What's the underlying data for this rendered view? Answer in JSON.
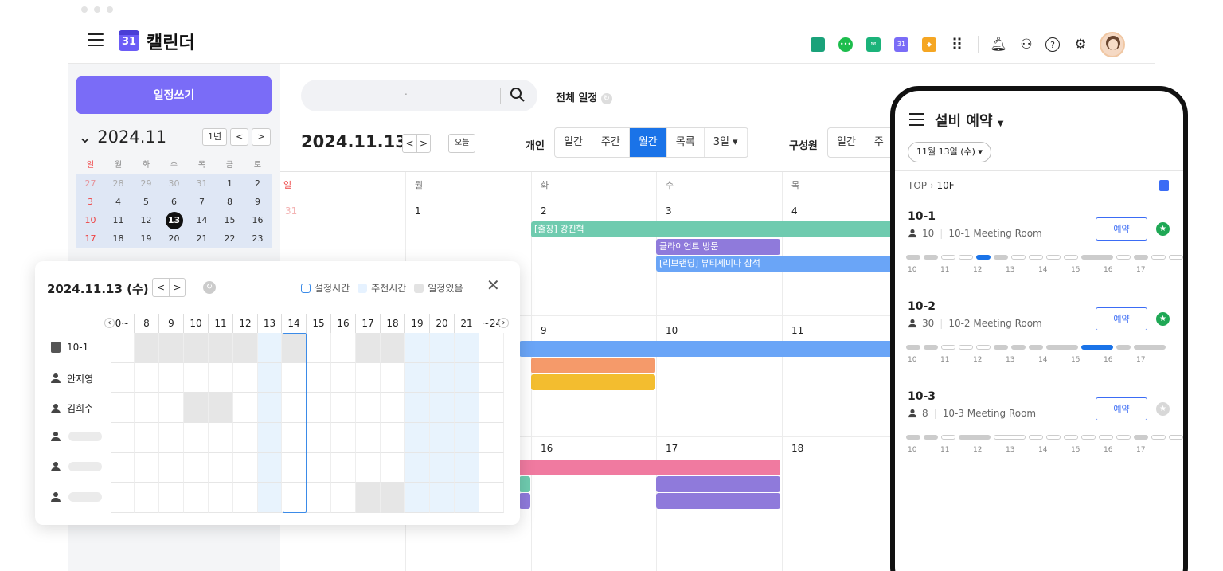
{
  "app": {
    "title": "캘린더",
    "logo_text": "31"
  },
  "toolbar": {
    "icons": [
      {
        "name": "dashboard-icon",
        "color": "#1aa27a",
        "label": ""
      },
      {
        "name": "messenger-icon",
        "color": "#1dbd4d",
        "label": "•••"
      },
      {
        "name": "mail-icon",
        "color": "#1bb37a",
        "label": "✉"
      },
      {
        "name": "calendar-app-icon",
        "color": "#7a6cf7",
        "label": "31"
      },
      {
        "name": "cube-icon",
        "color": "#f5a623",
        "label": "◆"
      },
      {
        "name": "apps-grid-icon",
        "color": "#222",
        "label": "⠿"
      }
    ],
    "utility": [
      {
        "name": "bell-icon",
        "glyph": "🔔︎"
      },
      {
        "name": "org-chart-icon",
        "glyph": "⚇"
      },
      {
        "name": "help-icon",
        "glyph": "?"
      },
      {
        "name": "settings-icon",
        "glyph": "⚙"
      }
    ]
  },
  "sidebar": {
    "write_label": "일정쓰기",
    "month": "2024.11",
    "year_btn": "1년",
    "weekdays": [
      "일",
      "월",
      "화",
      "수",
      "목",
      "금",
      "토"
    ],
    "weeks": [
      [
        "27",
        "28",
        "29",
        "30",
        "31",
        "1",
        "2"
      ],
      [
        "3",
        "4",
        "5",
        "6",
        "7",
        "8",
        "9"
      ],
      [
        "10",
        "11",
        "12",
        "13",
        "14",
        "15",
        "16"
      ],
      [
        "17",
        "18",
        "19",
        "20",
        "21",
        "22",
        "23"
      ]
    ],
    "today": "13"
  },
  "main": {
    "search_placeholder": ".",
    "all_label": "전체 일정",
    "date": "2024.11.13",
    "today_btn": "오늘",
    "personal_label": "개인",
    "personal_views": [
      "일간",
      "주간",
      "월간",
      "목록",
      "3일 ▾"
    ],
    "active_view": "월간",
    "member_label": "구성원",
    "member_views": [
      "일간",
      "주"
    ],
    "weekdays": [
      "일",
      "월",
      "화",
      "수",
      "목"
    ],
    "week_rows": [
      [
        "31",
        "1",
        "2",
        "3",
        "4"
      ],
      [
        "",
        "",
        "9",
        "10",
        "11"
      ],
      [
        "",
        "",
        "16",
        "17",
        "18"
      ]
    ],
    "events": [
      {
        "text": "[출장] 강진혁",
        "color": "#6fcbaf"
      },
      {
        "text": "클라이언트 방문",
        "color": "#8f7adb"
      },
      {
        "text": "[리브랜딩] 뷰티세미나 참석",
        "color": "#6aa5f7"
      }
    ]
  },
  "popup": {
    "date": "2024.11.13 (수)",
    "legend": [
      {
        "label": "설정시간",
        "color": "#3b8be8"
      },
      {
        "label": "추천시간",
        "color": "#e6f2ff"
      },
      {
        "label": "일정있음",
        "color": "#e3e3e3"
      }
    ],
    "hours": [
      "0~",
      "8",
      "9",
      "10",
      "11",
      "12",
      "13",
      "14",
      "15",
      "16",
      "17",
      "18",
      "19",
      "20",
      "21",
      "~24"
    ],
    "rows": [
      {
        "label": "10-1",
        "type": "room"
      },
      {
        "label": "안지영",
        "type": "person"
      },
      {
        "label": "김희수",
        "type": "person"
      },
      {
        "label": "",
        "type": "person"
      },
      {
        "label": "",
        "type": "person"
      },
      {
        "label": "",
        "type": "person"
      }
    ]
  },
  "phone": {
    "title": "설비 예약",
    "date_chip": "11월 13일 (수) ▾",
    "breadcrumb_root": "TOP",
    "breadcrumb_floor": "10F",
    "reserve_label": "예약",
    "time_labels": [
      "10",
      "11",
      "12",
      "13",
      "14",
      "15",
      "16",
      "17"
    ],
    "rooms": [
      {
        "id": "10-1",
        "capacity": "10",
        "name": "10-1 Meeting Room",
        "fav": true
      },
      {
        "id": "10-2",
        "capacity": "30",
        "name": "10-2 Meeting Room",
        "fav": true
      },
      {
        "id": "10-3",
        "capacity": "8",
        "name": "10-3 Meeting Room",
        "fav": false
      }
    ]
  }
}
